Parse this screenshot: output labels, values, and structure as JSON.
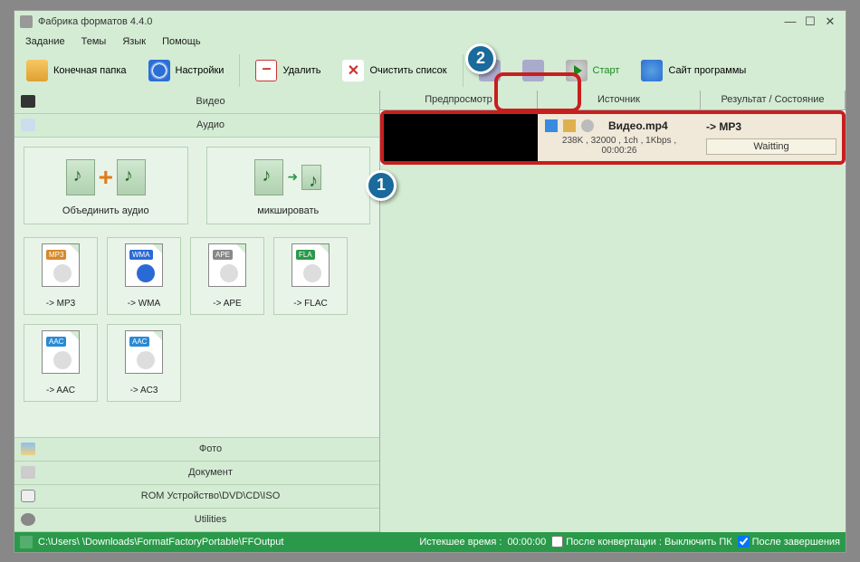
{
  "title": "Фабрика форматов 4.4.0",
  "menu": {
    "task": "Задание",
    "themes": "Темы",
    "lang": "Язык",
    "help": "Помощь"
  },
  "toolbar": {
    "outfolder": "Конечная папка",
    "settings": "Настройки",
    "delete": "Удалить",
    "clear": "Очистить список",
    "start": "Старт",
    "site": "Сайт программы"
  },
  "cats": {
    "video": "Видео",
    "audio": "Аудио",
    "photo": "Фото",
    "document": "Документ",
    "rom": "ROM Устройство\\DVD\\CD\\ISO",
    "utilities": "Utilities"
  },
  "audio": {
    "join": "Объединить аудио",
    "mix": "микшировать",
    "mp3": "-> MP3",
    "wma": "-> WMA",
    "ape": "-> APE",
    "flac": "-> FLAC",
    "aac": "-> AAC",
    "ac3": "-> AC3"
  },
  "columns": {
    "preview": "Предпросмотр",
    "source": "Источник",
    "result": "Результат / Состояние"
  },
  "task": {
    "filename": "Видео.mp4",
    "info": "238K , 32000 , 1ch , 1Kbps , 00:00:26",
    "target": "-> MP3",
    "state": "Waitting"
  },
  "status": {
    "path": "C:\\Users\\        \\Downloads\\FormatFactoryPortable\\FFOutput",
    "elapsed_label": "Истекшее время :",
    "elapsed_value": "00:00:00",
    "afterconv": "После конвертации : Выключить ПК",
    "aftercomplete": "После завершения"
  },
  "badges": {
    "b1": "1",
    "b2": "2"
  }
}
